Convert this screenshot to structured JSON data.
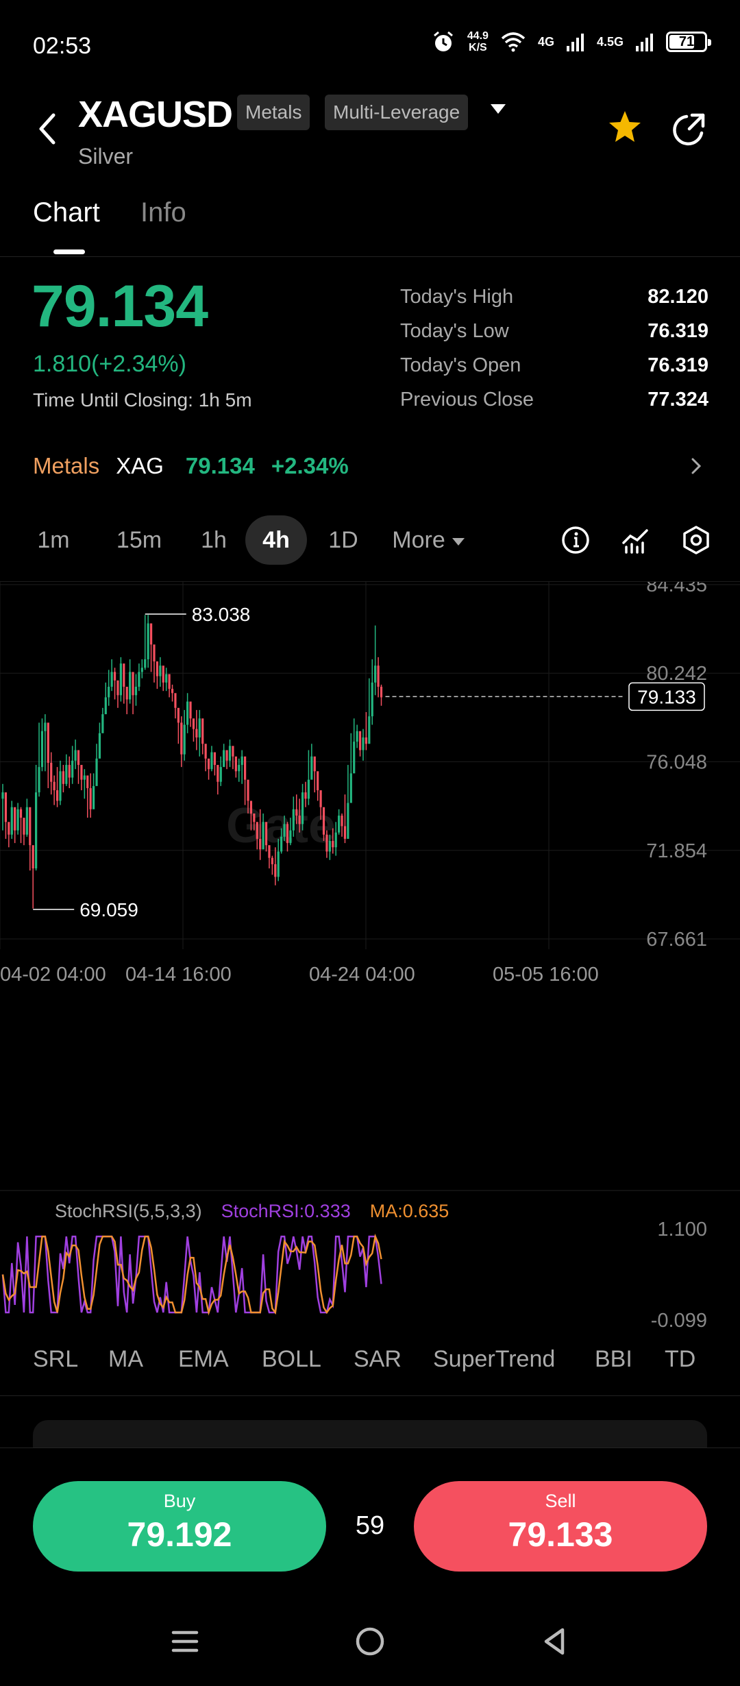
{
  "status": {
    "time": "02:53",
    "speed_value": "44.9",
    "speed_unit": "K/S",
    "net1": "4G",
    "net2": "4.5G",
    "battery": "71",
    "battery_level": 0.71
  },
  "header": {
    "symbol": "XAGUSD",
    "tag1": "Metals",
    "tag2": "Multi-Leverage",
    "name": "Silver"
  },
  "tabs": [
    "Chart",
    "Info"
  ],
  "price": {
    "last": "79.134",
    "change": "1.810(+2.34%)",
    "closing_label": "Time Until Closing:",
    "closing_value": "1h 5m"
  },
  "stats": [
    {
      "label": "Today's High",
      "value": "82.120"
    },
    {
      "label": "Today's Low",
      "value": "76.319"
    },
    {
      "label": "Today's Open",
      "value": "76.319"
    },
    {
      "label": "Previous Close",
      "value": "77.324"
    }
  ],
  "related": {
    "category": "Metals",
    "symbol": "XAG",
    "price": "79.134",
    "pct": "+2.34%"
  },
  "timeframes": [
    "1m",
    "15m",
    "1h",
    "4h",
    "1D",
    "More"
  ],
  "active_timeframe": "4h",
  "chart_data": {
    "type": "candlestick",
    "y_ticks": [
      "84.435",
      "80.242",
      "76.048",
      "71.854",
      "67.661"
    ],
    "ylim": [
      67.661,
      84.435
    ],
    "x_ticks": [
      "04-02 04:00",
      "04-14 16:00",
      "04-24 04:00",
      "05-05 16:00"
    ],
    "high_annotation": "83.038",
    "low_annotation": "69.059",
    "current_price_tag": "79.133",
    "watermark": "Gate",
    "closes": [
      74.6,
      73.2,
      72.6,
      73.9,
      72.8,
      73.8,
      73.4,
      72.6,
      73.9,
      72.1,
      71.0,
      74.6,
      75.8,
      77.5,
      77.9,
      76.0,
      75.1,
      74.7,
      74.2,
      75.6,
      75.0,
      75.9,
      75.3,
      76.1,
      76.6,
      75.9,
      75.2,
      75.4,
      74.8,
      73.8,
      74.9,
      76.2,
      77.4,
      78.3,
      79.1,
      79.6,
      80.3,
      79.9,
      79.2,
      80.7,
      79.6,
      79.0,
      80.3,
      79.2,
      79.6,
      80.3,
      80.5,
      80.9,
      82.6,
      81.6,
      80.8,
      80.1,
      80.6,
      79.8,
      80.2,
      79.5,
      79.3,
      78.6,
      77.9,
      76.4,
      77.8,
      78.9,
      78.1,
      77.6,
      77.2,
      78.1,
      76.9,
      76.2,
      75.7,
      76.5,
      75.9,
      75.1,
      75.8,
      76.6,
      76.1,
      76.8,
      76.3,
      75.6,
      75.9,
      76.3,
      75.2,
      74.2,
      73.6,
      73.2,
      72.4,
      71.9,
      73.2,
      72.1,
      71.5,
      71.2,
      70.6,
      71.8,
      72.5,
      73.1,
      72.2,
      72.8,
      73.8,
      73.5,
      73.1,
      74.6,
      74.3,
      75.2,
      76.3,
      75.6,
      74.7,
      73.9,
      72.6,
      71.8,
      72.3,
      72.0,
      72.7,
      73.5,
      73.0,
      72.4,
      74.1,
      75.5,
      77.0,
      77.5,
      76.6,
      77.2,
      76.9,
      78.2,
      79.8,
      80.6,
      79.6,
      79.1
    ],
    "highs": [
      75.0,
      74.3,
      73.0,
      74.2,
      73.3,
      74.1,
      73.9,
      73.0,
      74.3,
      72.5,
      71.5,
      75.9,
      77.9,
      78.1,
      78.3,
      76.8,
      76.5,
      75.4,
      75.8,
      76.1,
      75.9,
      76.4,
      76.3,
      76.8,
      77.1,
      76.4,
      75.9,
      75.7,
      75.2,
      75.5,
      75.5,
      76.9,
      77.9,
      78.6,
      79.8,
      80.4,
      80.9,
      80.5,
      79.7,
      81.0,
      80.3,
      79.6,
      80.9,
      79.8,
      80.2,
      80.7,
      80.9,
      83.0,
      83.0,
      81.9,
      81.1,
      80.5,
      81.0,
      80.2,
      80.5,
      80.0,
      79.7,
      79.0,
      78.5,
      78.2,
      78.5,
      79.3,
      78.5,
      78.0,
      78.5,
      78.5,
      77.6,
      76.6,
      76.1,
      76.8,
      76.4,
      75.8,
      76.3,
      76.9,
      76.6,
      77.1,
      76.7,
      76.1,
      76.2,
      76.6,
      75.6,
      74.5,
      74.0,
      73.5,
      73.0,
      73.8,
      73.6,
      72.6,
      71.9,
      71.6,
      72.0,
      72.4,
      72.9,
      73.5,
      73.2,
      73.4,
      74.4,
      74.5,
      74.3,
      75.0,
      75.1,
      76.6,
      76.9,
      76.1,
      75.2,
      74.3,
      73.2,
      72.8,
      72.6,
      72.9,
      73.2,
      73.8,
      73.6,
      74.5,
      75.9,
      77.4,
      78.1,
      77.8,
      77.3,
      77.6,
      78.4,
      80.0,
      80.9,
      82.5,
      81.0,
      79.7
    ],
    "lows": [
      72.8,
      72.4,
      72.0,
      72.4,
      72.2,
      72.6,
      72.2,
      72.1,
      72.5,
      70.9,
      69.1,
      70.9,
      74.4,
      75.6,
      75.6,
      74.8,
      74.5,
      74.0,
      73.9,
      74.0,
      74.6,
      74.9,
      74.8,
      75.0,
      75.7,
      75.0,
      74.7,
      74.3,
      73.4,
      73.4,
      74.5,
      75.9,
      76.8,
      77.6,
      78.3,
      78.7,
      79.4,
      79.0,
      78.6,
      78.9,
      78.8,
      78.3,
      78.8,
      78.3,
      78.7,
      79.4,
      80.0,
      80.4,
      80.5,
      80.3,
      79.8,
      79.5,
      79.6,
      79.4,
      79.4,
      79.1,
      78.9,
      78.1,
      76.9,
      75.8,
      76.1,
      77.4,
      77.7,
      77.0,
      76.6,
      76.3,
      76.4,
      75.6,
      75.2,
      75.6,
      75.4,
      74.5,
      74.9,
      75.9,
      75.7,
      75.8,
      75.7,
      75.3,
      75.1,
      75.0,
      74.0,
      73.6,
      72.8,
      72.8,
      71.9,
      71.4,
      72.1,
      71.8,
      71.0,
      70.7,
      70.2,
      70.4,
      71.7,
      72.3,
      71.8,
      72.1,
      72.5,
      73.1,
      72.7,
      72.8,
      73.9,
      74.0,
      75.4,
      74.6,
      74.2,
      73.3,
      72.3,
      71.5,
      71.4,
      71.7,
      71.6,
      72.6,
      72.5,
      72.2,
      73.7,
      74.8,
      75.8,
      76.7,
      76.3,
      76.1,
      76.6,
      76.9,
      77.8,
      79.2,
      79.1,
      78.7
    ]
  },
  "indicator": {
    "name": "StochRSI(5,5,3,3)",
    "value_label": "StochRSI:0.333",
    "ma_label": "MA:0.635",
    "y_max": "1.100",
    "y_min": "-0.099",
    "stoch_color": "#a040e0",
    "ma_color": "#f09030"
  },
  "indicator_tabs": [
    "SRL",
    "MA",
    "EMA",
    "BOLL",
    "SAR",
    "SuperTrend",
    "BBI",
    "TD"
  ],
  "trade": {
    "buy_label": "Buy",
    "buy_price": "79.192",
    "sell_label": "Sell",
    "sell_price": "79.133",
    "spread": "59"
  },
  "colors": {
    "up": "#23b780",
    "down": "#f5505f",
    "accent_orange": "#f0a060",
    "star": "#f5b800"
  }
}
